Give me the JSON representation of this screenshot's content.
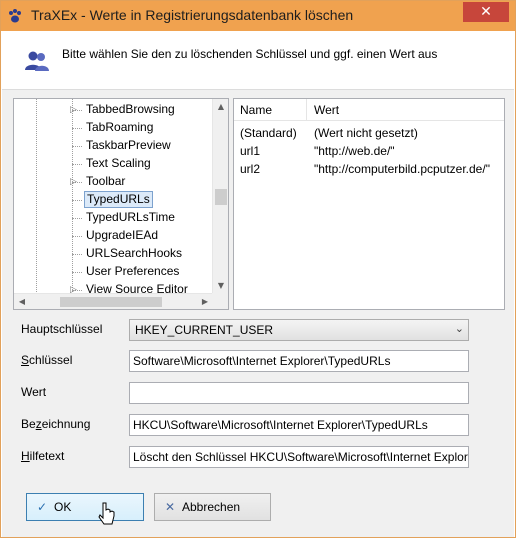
{
  "window": {
    "title": "TraXEx - Werte in Registrierungsdatenbank löschen",
    "close_glyph": "✕"
  },
  "header": {
    "text": "Bitte wählen Sie den zu löschenden Schlüssel und ggf. einen Wert aus",
    "icon": "users-icon"
  },
  "tree": {
    "items": [
      {
        "label": "TabbedBrowsing",
        "expandable": true
      },
      {
        "label": "TabRoaming",
        "expandable": false
      },
      {
        "label": "TaskbarPreview",
        "expandable": false
      },
      {
        "label": "Text Scaling",
        "expandable": false
      },
      {
        "label": "Toolbar",
        "expandable": true
      },
      {
        "label": "TypedURLs",
        "expandable": false,
        "selected": true
      },
      {
        "label": "TypedURLsTime",
        "expandable": false
      },
      {
        "label": "UpgradeIEAd",
        "expandable": false
      },
      {
        "label": "URLSearchHooks",
        "expandable": false
      },
      {
        "label": "User Preferences",
        "expandable": false
      },
      {
        "label": "View Source Editor",
        "expandable": true
      }
    ]
  },
  "values_list": {
    "columns": [
      "Name",
      "Wert"
    ],
    "rows": [
      {
        "name": "(Standard)",
        "value": "(Wert nicht gesetzt)"
      },
      {
        "name": "url1",
        "value": "\"http://web.de/\""
      },
      {
        "name": "url2",
        "value": "\"http://computerbild.pcputzer.de/\""
      }
    ]
  },
  "form": {
    "hauptschluessel": {
      "label": "Hauptschlüssel",
      "value": "HKEY_CURRENT_USER"
    },
    "schluessel": {
      "label_u": "S",
      "label_rest": "chlüssel",
      "value": "Software\\Microsoft\\Internet Explorer\\TypedURLs"
    },
    "wert": {
      "label": "Wert",
      "value": ""
    },
    "bezeichnung": {
      "label_pre": "Be",
      "label_u": "z",
      "label_rest": "eichnung",
      "value": "HKCU\\Software\\Microsoft\\Internet Explorer\\TypedURLs"
    },
    "hilfetext": {
      "label_u": "H",
      "label_rest": "ilfetext",
      "value": "Löscht den Schlüssel HKCU\\Software\\Microsoft\\Internet Explorer\\TypedURLs"
    }
  },
  "buttons": {
    "ok": {
      "label": "OK",
      "icon": "check-icon",
      "glyph": "✓"
    },
    "cancel": {
      "label": "Abbrechen",
      "icon": "x-icon",
      "glyph": "✕"
    }
  },
  "colors": {
    "titlebar": "#f0a24f",
    "close": "#c7463b",
    "selection": "#dceaf9"
  }
}
